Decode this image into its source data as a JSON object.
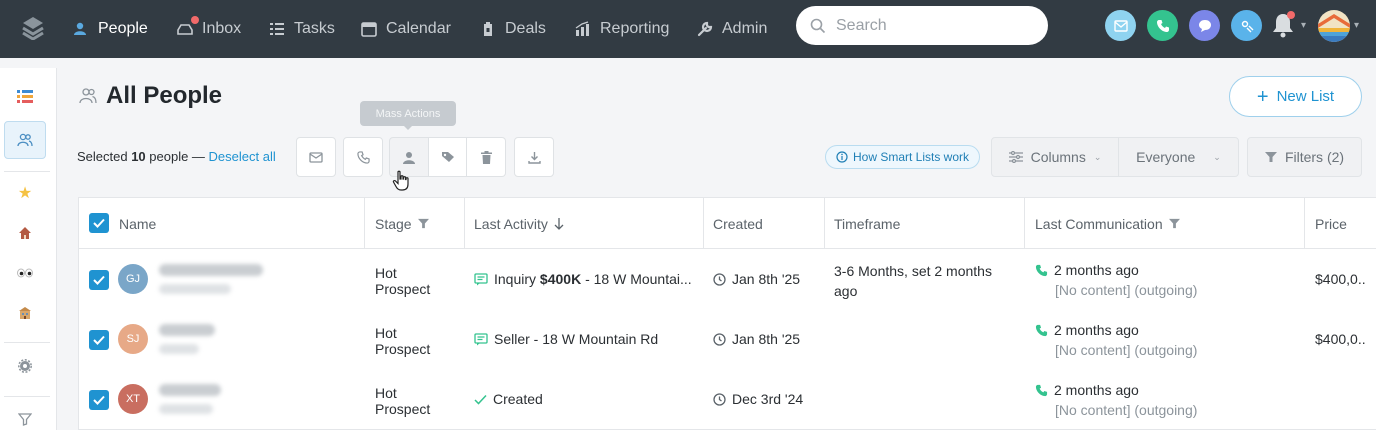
{
  "nav": {
    "items": [
      {
        "label": "People",
        "icon": "people-icon",
        "active": true
      },
      {
        "label": "Inbox",
        "icon": "inbox-icon"
      },
      {
        "label": "Tasks",
        "icon": "tasks-icon"
      },
      {
        "label": "Calendar",
        "icon": "calendar-icon"
      },
      {
        "label": "Deals",
        "icon": "deals-icon"
      },
      {
        "label": "Reporting",
        "icon": "reporting-icon"
      },
      {
        "label": "Admin",
        "icon": "admin-icon"
      }
    ],
    "search_placeholder": "Search",
    "quick_actions": [
      "email-icon",
      "phone-icon",
      "chat-icon",
      "dial-icon"
    ],
    "colors": {
      "bar": "#323b43",
      "email": "#8fd3f0",
      "phone": "#34c38f",
      "chat": "#7b86e8",
      "dial": "#5ab3ea"
    }
  },
  "rail": {
    "icons": [
      "list-icon",
      "people-icon",
      "star-icon",
      "house-icon",
      "eyes-icon",
      "building-icon",
      "gear-icon",
      "filter-icon"
    ]
  },
  "page": {
    "title": "All People",
    "new_list_label": "New List",
    "tooltip": "Mass Actions"
  },
  "selection": {
    "prefix": "Selected ",
    "count": "10",
    "suffix": " people — ",
    "deselect_label": "Deselect all"
  },
  "toolbar": {
    "smart_lists_label": "How Smart Lists work",
    "columns_label": "Columns",
    "owner_label": "Everyone",
    "filters_label": "Filters (2)"
  },
  "table": {
    "headers": {
      "name": "Name",
      "stage": "Stage",
      "last_activity": "Last Activity",
      "created": "Created",
      "timeframe": "Timeframe",
      "last_communication": "Last Communication",
      "price": "Price"
    },
    "rows": [
      {
        "initials": "GJ",
        "avatar_color": "#7aa6c8",
        "stage_line1": "Hot",
        "stage_line2": "Prospect",
        "activity_type": "message",
        "activity_pre": "Inquiry ",
        "activity_bold": "$400K",
        "activity_post": " - 18 W Mountai...",
        "created": "Jan 8th '25",
        "timeframe": "3-6 Months, set 2 months ago",
        "comm_when": "2 months ago",
        "comm_detail": "[No content] (outgoing)",
        "price": "$400,0..."
      },
      {
        "initials": "SJ",
        "avatar_color": "#e7a987",
        "stage_line1": "Hot",
        "stage_line2": "Prospect",
        "activity_type": "message",
        "activity_pre": "Seller - 18 W Mountain Rd",
        "activity_bold": "",
        "activity_post": "",
        "created": "Jan 8th '25",
        "timeframe": "",
        "comm_when": "2 months ago",
        "comm_detail": "[No content] (outgoing)",
        "price": "$400,0..."
      },
      {
        "initials": "XT",
        "avatar_color": "#c96e60",
        "stage_line1": "Hot",
        "stage_line2": "Prospect",
        "activity_type": "check",
        "activity_pre": "Created",
        "activity_bold": "",
        "activity_post": "",
        "created": "Dec 3rd '24",
        "timeframe": "",
        "comm_when": "2 months ago",
        "comm_detail": "[No content] (outgoing)",
        "price": ""
      }
    ]
  }
}
